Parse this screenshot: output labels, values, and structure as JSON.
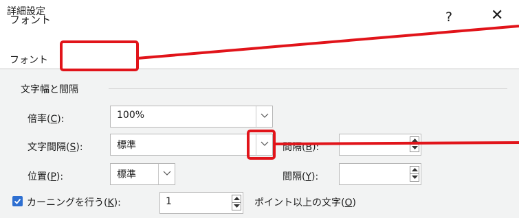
{
  "dialog": {
    "title": "フォント",
    "help_label": "?",
    "close_label": "✕"
  },
  "tabs": [
    {
      "label": "フォント"
    },
    {
      "label": "詳細設定"
    }
  ],
  "group": {
    "title": "文字幅と間隔"
  },
  "fields": {
    "scale": {
      "label": "倍率(",
      "key": "C",
      "suffix": "):",
      "value": "100%"
    },
    "spacing": {
      "label": "文字間隔(",
      "key": "S",
      "suffix": "):",
      "value": "標準"
    },
    "spacing_by": {
      "label": "間隔(",
      "key": "B",
      "suffix": "):",
      "value": ""
    },
    "position": {
      "label": "位置(",
      "key": "P",
      "suffix": "):",
      "value": "標準"
    },
    "position_by": {
      "label": "間隔(",
      "key": "Y",
      "suffix": "):",
      "value": ""
    },
    "kerning": {
      "label": "カーニングを行う(",
      "key": "K",
      "suffix": "):",
      "value": "1",
      "checked": true,
      "after": "ポイント以上の文字(",
      "after_key": "O",
      "after_suffix": ")"
    }
  },
  "icons": {
    "dropdown": "chevron-down-icon",
    "spinner": "spin-arrows-icon",
    "check": "check-icon"
  },
  "colors": {
    "highlight": "#e1141a",
    "checkbox": "#2e6fd1"
  }
}
